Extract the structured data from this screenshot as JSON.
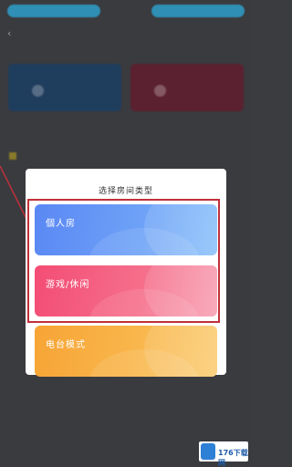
{
  "background": {
    "top_left_pill": "",
    "top_right_pill": "",
    "back_glyph": "‹",
    "title": "",
    "card_blue_text": "",
    "card_red_text": "",
    "row_text": ""
  },
  "modal": {
    "title": "选择房间类型",
    "options": [
      {
        "label": "個人房",
        "desc": ""
      },
      {
        "label": "游戏/休闲",
        "desc": ""
      },
      {
        "label": "电台模式",
        "desc": ""
      }
    ]
  },
  "watermark": {
    "text": "176下载网"
  },
  "colors": {
    "solo": "#5a88f4",
    "game": "#f44d75",
    "radio": "#f7a435",
    "highlight": "#c0303a"
  }
}
